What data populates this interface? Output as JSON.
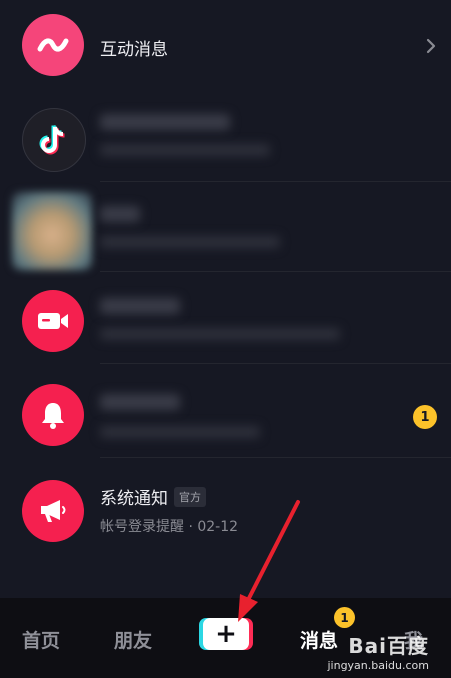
{
  "messages": [
    {
      "id": "interactive",
      "title": "互动消息",
      "icon": "wave-icon",
      "color": "#f5457a"
    },
    {
      "id": "douyin",
      "icon": "tiktok-logo-icon",
      "color": "#1f1f27"
    },
    {
      "id": "contact",
      "icon": "blurred-avatar",
      "color": "#c9a07a"
    },
    {
      "id": "video",
      "icon": "video-camera-icon",
      "color": "#f5204f"
    },
    {
      "id": "notification",
      "icon": "bell-icon",
      "color": "#f5204f",
      "unread": "1"
    },
    {
      "id": "system",
      "title": "系统通知",
      "tag": "官方",
      "subtitle": "帐号登录提醒 · 02-12",
      "icon": "megaphone-icon",
      "color": "#f5204f"
    }
  ],
  "tabbar": {
    "home": "首页",
    "friends": "朋友",
    "create_icon": "plus-icon",
    "messages": "消息",
    "messages_badge": "1",
    "me": "我",
    "active": "messages"
  },
  "watermark": {
    "logo": "Bai百度",
    "url": "jingyan.baidu.com"
  },
  "colors": {
    "background": "#161823",
    "accent": "#fe2c55",
    "badge": "#fcc22a",
    "arrow": "#e8212e"
  }
}
